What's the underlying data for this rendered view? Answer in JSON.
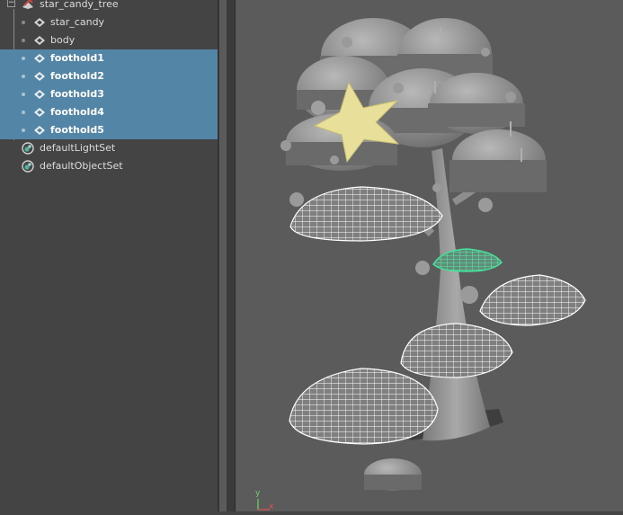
{
  "outliner": {
    "root": {
      "label": "star_candy_tree",
      "icon": "group-transform-icon"
    },
    "items": [
      {
        "label": "star_candy",
        "selected": false,
        "icon": "mesh-transform-icon"
      },
      {
        "label": "body",
        "selected": false,
        "icon": "mesh-transform-icon"
      },
      {
        "label": "foothold1",
        "selected": true,
        "icon": "mesh-transform-icon"
      },
      {
        "label": "foothold2",
        "selected": true,
        "icon": "mesh-transform-icon"
      },
      {
        "label": "foothold3",
        "selected": true,
        "icon": "mesh-transform-icon"
      },
      {
        "label": "foothold4",
        "selected": true,
        "icon": "mesh-transform-icon"
      },
      {
        "label": "foothold5",
        "selected": true,
        "icon": "mesh-transform-icon"
      }
    ],
    "sets": [
      {
        "label": "defaultLightSet",
        "icon": "set-icon"
      },
      {
        "label": "defaultObjectSet",
        "icon": "set-icon"
      }
    ],
    "colors": {
      "selection": "#5285a6",
      "panel": "#444444",
      "viewport": "#5b5b5b",
      "star": "#e8e09a",
      "active_wire": "#43e39a"
    }
  },
  "viewport": {
    "axis_label_y": "y",
    "axis_label_x": "x"
  }
}
